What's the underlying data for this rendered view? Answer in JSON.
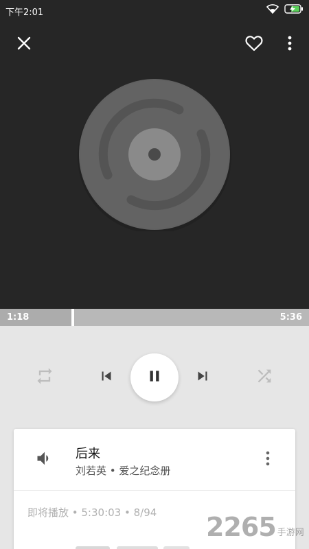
{
  "status_bar": {
    "time": "下午2:01"
  },
  "player": {
    "current_time": "1:18",
    "total_time": "5:36",
    "progress_fraction": 0.232
  },
  "now_playing": {
    "title": "后来",
    "subtitle": "刘若英 • 爱之纪念册"
  },
  "queue": {
    "up_next": "即将播放 • 5:30:03 • 8/94"
  },
  "watermark": {
    "number": "2265",
    "text": "手游网"
  },
  "icons": {
    "close": "close-icon",
    "favorite": "heart-outline-icon",
    "more": "more-vert-icon",
    "repeat": "repeat-icon",
    "previous": "skip-previous-icon",
    "pause": "pause-icon",
    "next": "skip-next-icon",
    "shuffle": "shuffle-icon",
    "volume": "volume-icon"
  },
  "colors": {
    "header_bg": "#262626",
    "progress_bg": "#b8b8b8",
    "page_bg": "#e6e6e6"
  }
}
